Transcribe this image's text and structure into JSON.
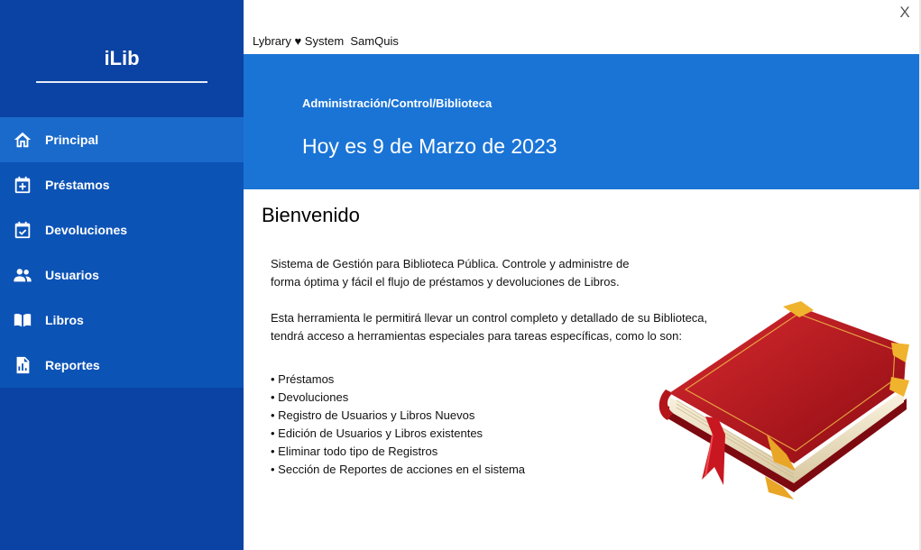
{
  "sidebar": {
    "logo": "iLib",
    "items": [
      {
        "label": "Principal",
        "icon": "home-icon",
        "active": true
      },
      {
        "label": "Préstamos",
        "icon": "calendar-plus-icon",
        "active": false
      },
      {
        "label": "Devoluciones",
        "icon": "calendar-check-icon",
        "active": false
      },
      {
        "label": "Usuarios",
        "icon": "users-icon",
        "active": false
      },
      {
        "label": "Libros",
        "icon": "book-open-icon",
        "active": false
      },
      {
        "label": "Reportes",
        "icon": "report-icon",
        "active": false
      }
    ]
  },
  "header": {
    "app_title": "Lybrary ♥ System  SamQuis",
    "close_label": "X"
  },
  "banner": {
    "breadcrumb": "Administración/Control/Biblioteca",
    "date_text": "Hoy es 9 de Marzo de 2023"
  },
  "content": {
    "welcome": "Bienvenido",
    "paragraphs": [
      "Sistema de Gestión para Biblioteca Pública. Controle y administre de",
      "forma óptima y fácil el flujo de préstamos y devoluciones de Libros.",
      "Esta herramienta le permitirá llevar un control completo y detallado de su Biblioteca,",
      "tendrá acceso a herramientas especiales para tareas específicas, como lo son:"
    ],
    "features": [
      "• Préstamos",
      "• Devoluciones",
      "• Registro de Usuarios y Libros Nuevos",
      "• Edición de Usuarios y Libros existentes",
      "• Eliminar todo tipo de Registros",
      "• Sección de Reportes de acciones en el sistema"
    ]
  },
  "colors": {
    "sidebar": "#0a43a3",
    "nav_band": "#0c53b6",
    "nav_active": "#1a6acb",
    "banner": "#1a74d6",
    "book_red": "#c0161d"
  }
}
